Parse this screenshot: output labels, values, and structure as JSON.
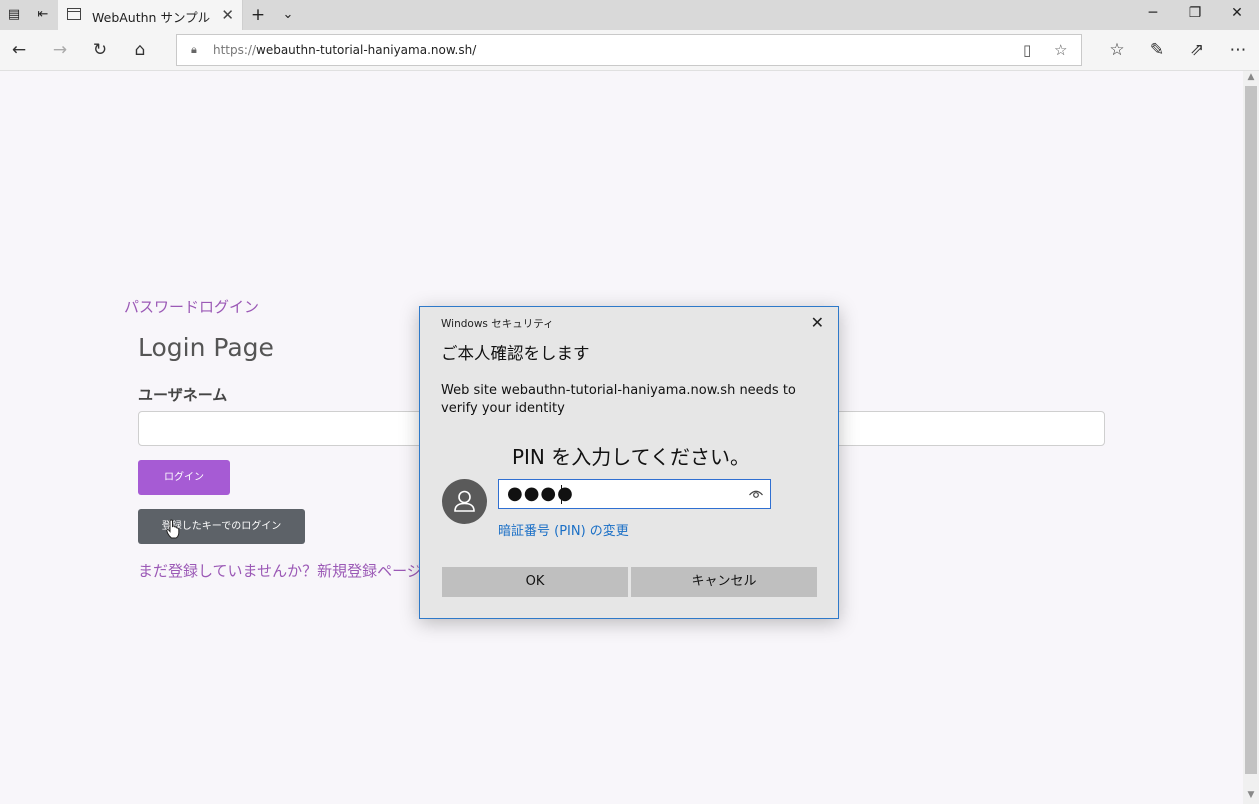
{
  "browser": {
    "tab": {
      "title": "WebAuthn サンプル"
    },
    "address": {
      "scheme": "https://",
      "host": "webauthn-tutorial-haniyama.now.sh/"
    }
  },
  "page": {
    "password_login_link": "パスワードログイン",
    "title": "Login Page",
    "username_label": "ユーザネーム",
    "username_value": "",
    "login_button": "ログイン",
    "security_key_button": "登録したキーでのログイン",
    "register_link": "まだ登録していませんか？新規登録ページ"
  },
  "dialog": {
    "caption": "Windows セキュリティ",
    "heading": "ご本人確認をします",
    "message": "Web site webauthn-tutorial-haniyama.now.sh needs to verify your identity",
    "prompt": "PIN を入力してください。",
    "pin_masked": "●●●●",
    "change_pin_link": "暗証番号 (PIN) の変更",
    "ok_button": "OK",
    "cancel_button": "キャンセル"
  },
  "colors": {
    "accent_purple": "#a65bd4",
    "link_purple": "#9b59b6",
    "dialog_border": "#2e79c9",
    "pin_link": "#1a6fc6"
  }
}
